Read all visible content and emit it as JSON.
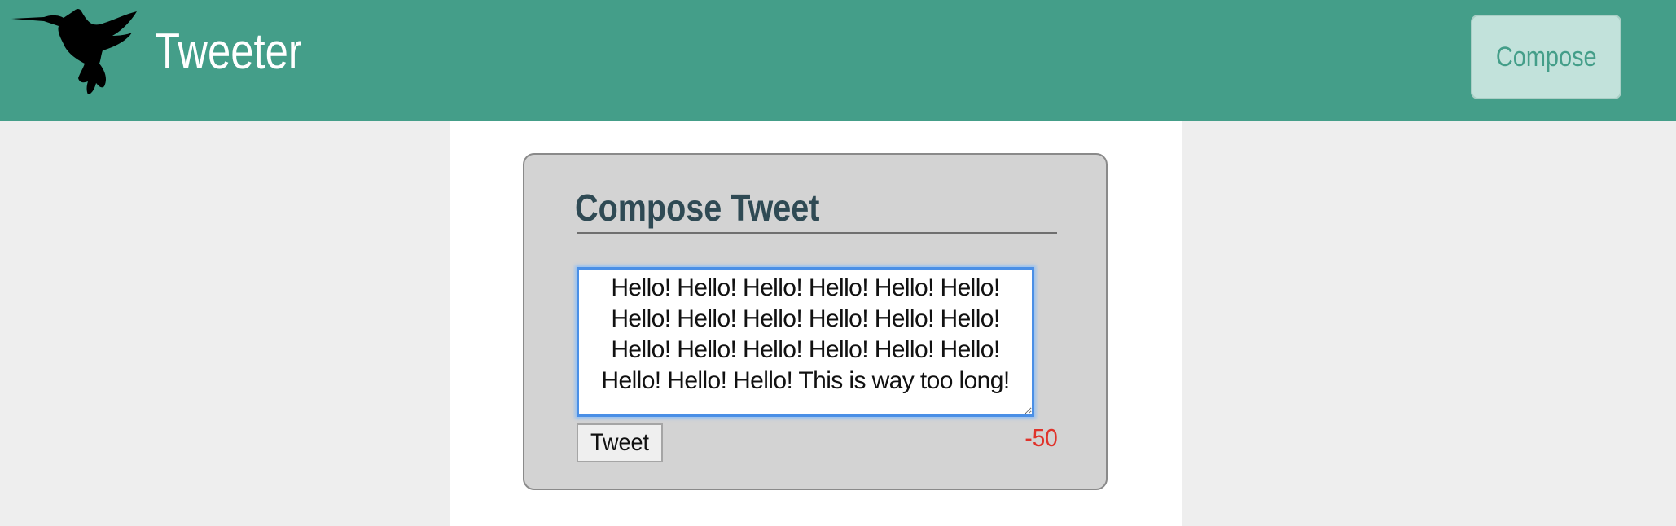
{
  "header": {
    "brand": "Tweeter",
    "compose_label": "Compose",
    "logo_icon": "hummingbird-icon"
  },
  "composer": {
    "title": "Compose Tweet",
    "tweet_value": "Hello! Hello! Hello! Hello! Hello! Hello! Hello! Hello! Hello! Hello! Hello! Hello! Hello! Hello! Hello! Hello! Hello! Hello! Hello! Hello! Hello! This is way too long!",
    "tweet_button_label": "Tweet",
    "char_counter": "-50"
  },
  "colors": {
    "navbar": "#449e89",
    "compose_button_bg": "#c2e2db",
    "panel_bg": "#d3d3d3",
    "title_color": "#2f4a54",
    "counter_over_limit": "#e0322a"
  }
}
